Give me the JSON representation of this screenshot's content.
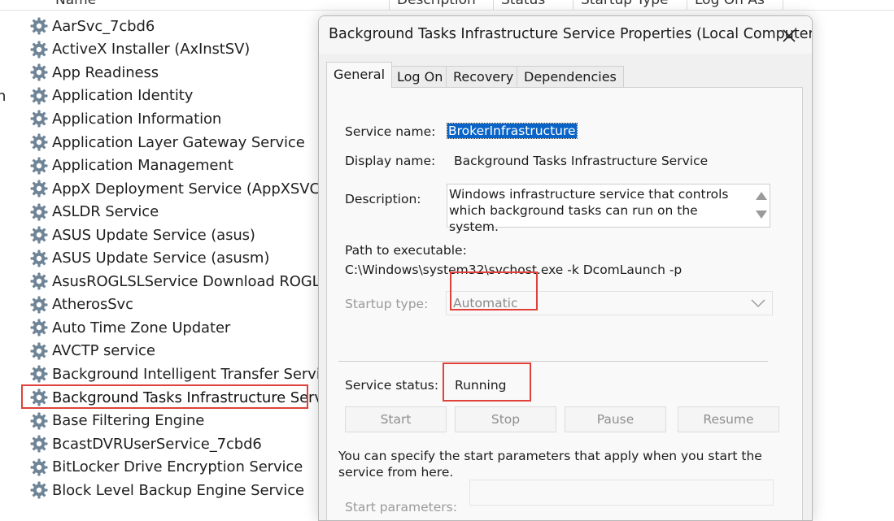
{
  "columns": {
    "name": "Name",
    "description": "Description",
    "status": "Status",
    "startup_type": "Startup Type",
    "log_on_as": "Log On As"
  },
  "edge_text": "n",
  "services": [
    "AarSvc_7cbd6",
    "ActiveX Installer (AxInstSV)",
    "App Readiness",
    "Application Identity",
    "Application Information",
    "Application Layer Gateway Service",
    "Application Management",
    "AppX Deployment Service (AppXSVC)",
    "ASLDR Service",
    "ASUS Update Service (asus)",
    "ASUS Update Service (asusm)",
    "AsusROGLSLService Download ROGLSLoad",
    "AtherosSvc",
    "Auto Time Zone Updater",
    "AVCTP service",
    "Background Intelligent Transfer Service",
    "Background Tasks Infrastructure Service",
    "Base Filtering Engine",
    "BcastDVRUserService_7cbd6",
    "BitLocker Drive Encryption Service",
    "Block Level Backup Engine Service"
  ],
  "selected_service_index": 16,
  "dialog": {
    "title": "Background Tasks Infrastructure Service Properties (Local Computer)",
    "tabs": [
      "General",
      "Log On",
      "Recovery",
      "Dependencies"
    ],
    "active_tab": "General",
    "general": {
      "service_name_label": "Service name:",
      "service_name": "BrokerInfrastructure",
      "display_name_label": "Display name:",
      "display_name": "Background Tasks Infrastructure Service",
      "description_label": "Description:",
      "description": "Windows infrastructure service that controls which background tasks can run on the system.",
      "path_label": "Path to executable:",
      "path": "C:\\Windows\\system32\\svchost.exe -k DcomLaunch -p",
      "startup_type_label": "Startup type:",
      "startup_type": "Automatic",
      "service_status_label": "Service status:",
      "service_status": "Running",
      "buttons": {
        "start": "Start",
        "stop": "Stop",
        "pause": "Pause",
        "resume": "Resume"
      },
      "help_text": "You can specify the start parameters that apply when you start the service from here.",
      "start_params_label": "Start parameters:"
    }
  },
  "colors": {
    "highlight_border": "#e0413a",
    "selection_blue": "#0a64c8"
  }
}
